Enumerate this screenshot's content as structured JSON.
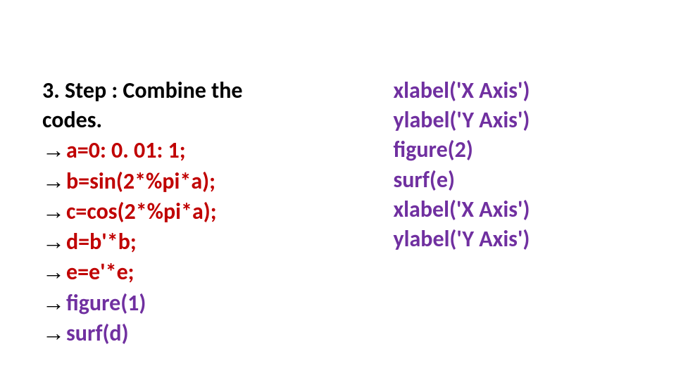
{
  "left": {
    "heading_l1": "3. Step : Combine the",
    "heading_l2": "codes.",
    "arrow": "→",
    "lines": [
      "a=0: 0. 01: 1;",
      "b=sin(2*%pi*a);",
      "c=cos(2*%pi*a);",
      "d=b'*b;",
      "e=e'*e;",
      "figure(1)",
      "surf(d)"
    ]
  },
  "right": {
    "lines": [
      "xlabel('X Axis')",
      "ylabel('Y Axis')",
      "figure(2)",
      "surf(e)",
      "xlabel('X Axis')",
      "ylabel('Y Axis')"
    ]
  }
}
